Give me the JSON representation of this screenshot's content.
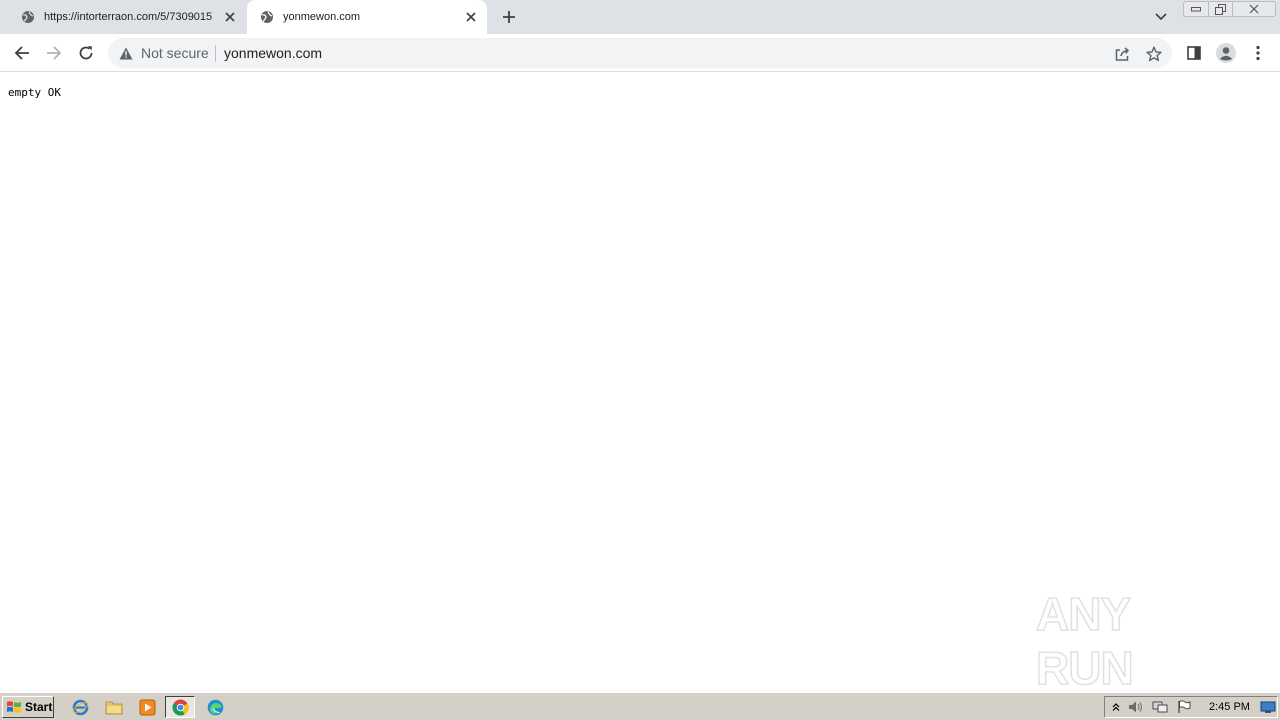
{
  "browser": {
    "tabs": [
      {
        "title": "https://intorterraon.com/5/7309015",
        "active": false
      },
      {
        "title": "yonmewon.com",
        "active": true
      }
    ],
    "omnibox": {
      "security_label": "Not secure",
      "url": "yonmewon.com"
    },
    "icons": {
      "back": "back-arrow-icon",
      "forward": "forward-arrow-icon",
      "reload": "reload-icon",
      "share": "share-icon",
      "bookmark": "star-icon",
      "sidepanel": "side-panel-icon",
      "profile": "profile-icon",
      "menu": "kebab-menu-icon"
    }
  },
  "page": {
    "body_text": "empty OK"
  },
  "watermark": {
    "text": "ANY RUN"
  },
  "taskbar": {
    "start_label": "Start",
    "clock": "2:45 PM",
    "pinned": [
      "internet-explorer-icon",
      "folder-icon",
      "media-player-icon",
      "chrome-icon",
      "edge-icon"
    ]
  },
  "colors": {
    "tabstrip": "#dee1e6",
    "omnibox": "#f1f3f4",
    "taskbar": "#d4d0c8"
  }
}
